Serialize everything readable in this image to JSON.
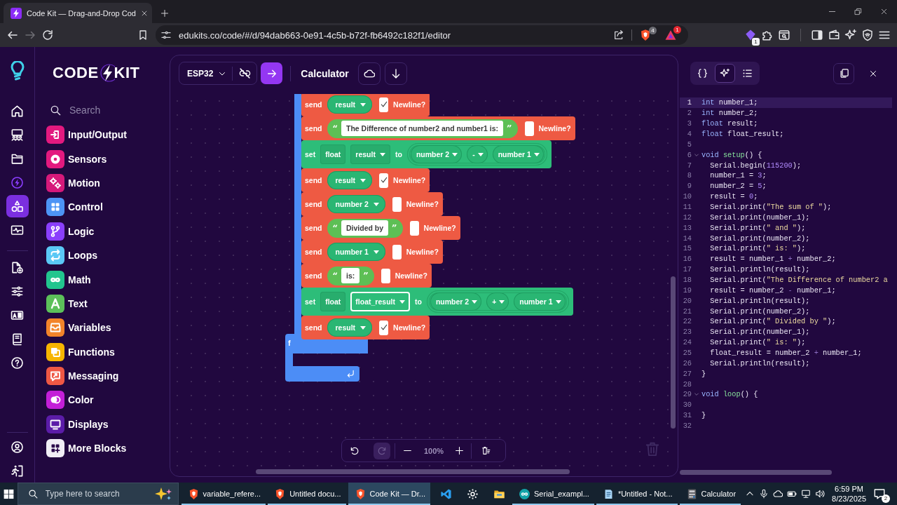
{
  "browser": {
    "tab": {
      "title": "Code Kit — Drag-and-Drop Cod"
    },
    "nav": [
      {
        "disabled": false
      },
      {
        "disabled": true
      },
      {
        "disabled": false
      }
    ],
    "url": "edukits.co/code/#/d/94dab663-0e91-4c5b-b72f-fb6492c182f1/editor",
    "shields_badge": "4",
    "rewards_badge": "1",
    "extension_badge": "1"
  },
  "rail": {
    "items": [
      {
        "selected": false
      },
      {
        "selected": false
      },
      {
        "selected": false
      },
      {
        "selected": false
      },
      {
        "selected": true
      },
      {
        "selected": false
      },
      {
        "selected": false
      },
      {
        "selected": false
      },
      {
        "selected": false
      },
      {
        "selected": false
      },
      {
        "selected": false
      },
      {
        "selected": false
      },
      {
        "selected": false
      }
    ]
  },
  "palette": {
    "logo": {
      "left": "CODE",
      "right": "KIT"
    },
    "search": {
      "placeholder": "Search"
    },
    "categories": [
      {
        "label": "Input/Output",
        "color": "#e3197f"
      },
      {
        "label": "Sensors",
        "color": "#e3197f"
      },
      {
        "label": "Motion",
        "color": "#d6197a"
      },
      {
        "label": "Control",
        "color": "#4d94f5"
      },
      {
        "label": "Logic",
        "color": "#8a3ffc"
      },
      {
        "label": "Loops",
        "color": "#5ac8f5"
      },
      {
        "label": "Math",
        "color": "#22c58e"
      },
      {
        "label": "Text",
        "color": "#5cc05a"
      },
      {
        "label": "Variables",
        "color": "#f2842a"
      },
      {
        "label": "Functions",
        "color": "#f7b500"
      },
      {
        "label": "Messaging",
        "color": "#ef5844"
      },
      {
        "label": "Color",
        "color": "#c31fd8"
      },
      {
        "label": "Displays",
        "color": "#5b1ca8"
      },
      {
        "label": "More Blocks",
        "color": "#f0eef5"
      }
    ]
  },
  "toolbar": {
    "board": "ESP32",
    "project": "Calculator"
  },
  "canvas": {
    "blocks": [
      {
        "kind": "send",
        "label": "send",
        "value": {
          "kind": "variable",
          "name": "result"
        },
        "newline": true,
        "newline_label": "Newline?"
      },
      {
        "kind": "send",
        "label": "send",
        "value": {
          "kind": "text",
          "open_quote": "“",
          "text": "The Difference of number2 and number1 is:",
          "close_quote": "”"
        },
        "newline": false,
        "newline_label": "Newline?"
      },
      {
        "kind": "set",
        "label": "set",
        "type": "float",
        "variable": {
          "name": "result",
          "selected": false
        },
        "to_label": "to",
        "expression": {
          "left": "number 2",
          "operator": "-",
          "right": "number 1"
        }
      },
      {
        "kind": "send",
        "label": "send",
        "value": {
          "kind": "variable",
          "name": "result"
        },
        "newline": true,
        "newline_label": "Newline?"
      },
      {
        "kind": "send",
        "label": "send",
        "value": {
          "kind": "variable",
          "name": "number 2"
        },
        "newline": false,
        "newline_label": "Newline?"
      },
      {
        "kind": "send",
        "label": "send",
        "value": {
          "kind": "text",
          "open_quote": "“",
          "text": "Divided by",
          "close_quote": "”"
        },
        "newline": false,
        "newline_label": "Newline?"
      },
      {
        "kind": "send",
        "label": "send",
        "value": {
          "kind": "variable",
          "name": "number 1"
        },
        "newline": false,
        "newline_label": "Newline?"
      },
      {
        "kind": "send",
        "label": "send",
        "value": {
          "kind": "text",
          "open_quote": "“",
          "text": "is:",
          "close_quote": "”"
        },
        "newline": false,
        "newline_label": "Newline?"
      },
      {
        "kind": "set",
        "label": "set",
        "type": "float",
        "variable": {
          "name": "float_result",
          "selected": true
        },
        "to_label": "to",
        "expression": {
          "left": "number 2",
          "operator": "+",
          "right": "number 1"
        }
      },
      {
        "kind": "send",
        "label": "send",
        "value": {
          "kind": "variable",
          "name": "result"
        },
        "newline": true,
        "newline_label": "Newline?"
      }
    ],
    "function_block": {
      "label": "f"
    },
    "controls": {
      "undo": {
        "disabled": false
      },
      "redo": {
        "disabled": true
      },
      "zoom": "100%"
    }
  },
  "code_panel": {
    "views": [
      {
        "selected": false
      },
      {
        "selected": true
      },
      {
        "selected": false
      }
    ],
    "lines": [
      {
        "number": "1",
        "active": true,
        "tokens": [
          {
            "kind": "keyword",
            "text": "int"
          },
          {
            "kind": "plain",
            "text": " number_1;"
          }
        ]
      },
      {
        "number": "2",
        "active": false,
        "tokens": [
          {
            "kind": "keyword",
            "text": "int"
          },
          {
            "kind": "plain",
            "text": " number_2;"
          }
        ]
      },
      {
        "number": "3",
        "active": false,
        "tokens": [
          {
            "kind": "keyword",
            "text": "float"
          },
          {
            "kind": "plain",
            "text": " result;"
          }
        ]
      },
      {
        "number": "4",
        "active": false,
        "tokens": [
          {
            "kind": "keyword",
            "text": "float"
          },
          {
            "kind": "plain",
            "text": " float_result;"
          }
        ]
      },
      {
        "number": "5",
        "active": false
      },
      {
        "number": "6",
        "active": false,
        "expanded": true,
        "tokens": [
          {
            "kind": "keyword",
            "text": "void"
          },
          {
            "kind": "function",
            "text": " setup"
          },
          {
            "kind": "plain",
            "text": "() {"
          }
        ]
      },
      {
        "number": "7",
        "active": false,
        "tokens": [
          {
            "kind": "plain",
            "text": "  Serial.begin("
          },
          {
            "kind": "number",
            "text": "115200"
          },
          {
            "kind": "plain",
            "text": ");"
          }
        ]
      },
      {
        "number": "8",
        "active": false,
        "tokens": [
          {
            "kind": "plain",
            "text": "  number_1 = "
          },
          {
            "kind": "number",
            "text": "3"
          },
          {
            "kind": "plain",
            "text": ";"
          }
        ]
      },
      {
        "number": "9",
        "active": false,
        "tokens": [
          {
            "kind": "plain",
            "text": "  number_2 = "
          },
          {
            "kind": "number",
            "text": "5"
          },
          {
            "kind": "plain",
            "text": ";"
          }
        ]
      },
      {
        "number": "10",
        "active": false,
        "tokens": [
          {
            "kind": "plain",
            "text": "  result = "
          },
          {
            "kind": "number",
            "text": "0"
          },
          {
            "kind": "plain",
            "text": ";"
          }
        ]
      },
      {
        "number": "11",
        "active": false,
        "tokens": [
          {
            "kind": "plain",
            "text": "  Serial.print("
          },
          {
            "kind": "string",
            "text": "\"The sum of \""
          },
          {
            "kind": "plain",
            "text": ");"
          }
        ]
      },
      {
        "number": "12",
        "active": false,
        "tokens": [
          {
            "kind": "plain",
            "text": "  Serial.print(number_1);"
          }
        ]
      },
      {
        "number": "13",
        "active": false,
        "tokens": [
          {
            "kind": "plain",
            "text": "  Serial.print("
          },
          {
            "kind": "string",
            "text": "\" and \""
          },
          {
            "kind": "plain",
            "text": ");"
          }
        ]
      },
      {
        "number": "14",
        "active": false,
        "tokens": [
          {
            "kind": "plain",
            "text": "  Serial.print(number_2);"
          }
        ]
      },
      {
        "number": "15",
        "active": false,
        "tokens": [
          {
            "kind": "plain",
            "text": "  Serial.print("
          },
          {
            "kind": "string",
            "text": "\" is: \""
          },
          {
            "kind": "plain",
            "text": ");"
          }
        ]
      },
      {
        "number": "16",
        "active": false,
        "tokens": [
          {
            "kind": "plain",
            "text": "  result = number_1 "
          },
          {
            "kind": "operator",
            "text": "+"
          },
          {
            "kind": "plain",
            "text": " number_2;"
          }
        ]
      },
      {
        "number": "17",
        "active": false,
        "tokens": [
          {
            "kind": "plain",
            "text": "  Serial.println(result);"
          }
        ]
      },
      {
        "number": "18",
        "active": false,
        "tokens": [
          {
            "kind": "plain",
            "text": "  Serial.print("
          },
          {
            "kind": "string",
            "text": "\"The Difference of number2 a"
          }
        ]
      },
      {
        "number": "19",
        "active": false,
        "tokens": [
          {
            "kind": "plain",
            "text": "  result = number_2 "
          },
          {
            "kind": "operator",
            "text": "-"
          },
          {
            "kind": "plain",
            "text": " number_1;"
          }
        ]
      },
      {
        "number": "20",
        "active": false,
        "tokens": [
          {
            "kind": "plain",
            "text": "  Serial.println(result);"
          }
        ]
      },
      {
        "number": "21",
        "active": false,
        "tokens": [
          {
            "kind": "plain",
            "text": "  Serial.print(number_2);"
          }
        ]
      },
      {
        "number": "22",
        "active": false,
        "tokens": [
          {
            "kind": "plain",
            "text": "  Serial.print("
          },
          {
            "kind": "string",
            "text": "\" Divided by \""
          },
          {
            "kind": "plain",
            "text": ");"
          }
        ]
      },
      {
        "number": "23",
        "active": false,
        "tokens": [
          {
            "kind": "plain",
            "text": "  Serial.print(number_1);"
          }
        ]
      },
      {
        "number": "24",
        "active": false,
        "tokens": [
          {
            "kind": "plain",
            "text": "  Serial.print("
          },
          {
            "kind": "string",
            "text": "\" is: \""
          },
          {
            "kind": "plain",
            "text": ");"
          }
        ]
      },
      {
        "number": "25",
        "active": false,
        "tokens": [
          {
            "kind": "plain",
            "text": "  float_result = number_2 "
          },
          {
            "kind": "operator",
            "text": "+"
          },
          {
            "kind": "plain",
            "text": " number_1;"
          }
        ]
      },
      {
        "number": "26",
        "active": false,
        "tokens": [
          {
            "kind": "plain",
            "text": "  Serial.println(result);"
          }
        ]
      },
      {
        "number": "27",
        "active": false,
        "tokens": [
          {
            "kind": "plain",
            "text": "}"
          }
        ]
      },
      {
        "number": "28",
        "active": false
      },
      {
        "number": "29",
        "active": false,
        "expanded": true,
        "tokens": [
          {
            "kind": "keyword",
            "text": "void"
          },
          {
            "kind": "function",
            "text": " loop"
          },
          {
            "kind": "plain",
            "text": "() {"
          }
        ]
      },
      {
        "number": "30",
        "active": false
      },
      {
        "number": "31",
        "active": false,
        "tokens": [
          {
            "kind": "plain",
            "text": "}"
          }
        ]
      },
      {
        "number": "32",
        "active": false
      }
    ]
  },
  "taskbar": {
    "search": {
      "placeholder": "Type here to search"
    },
    "apps": [
      {
        "label": "variable_refere...",
        "selected": false,
        "running": true
      },
      {
        "label": "Untitled docu...",
        "selected": false,
        "running": true
      },
      {
        "label": "Code Kit — Dr...",
        "selected": true,
        "running": true
      },
      {
        "selected": false,
        "running": false
      },
      {
        "selected": false,
        "running": false
      },
      {
        "selected": false,
        "running": false
      },
      {
        "label": "Serial_exampl...",
        "selected": false,
        "running": true
      },
      {
        "label": "*Untitled - Not...",
        "selected": false,
        "running": true
      },
      {
        "label": "Calculator",
        "selected": false,
        "running": true
      }
    ],
    "time": "6:59 PM",
    "date": "8/23/2025",
    "notification_badge": "2"
  }
}
